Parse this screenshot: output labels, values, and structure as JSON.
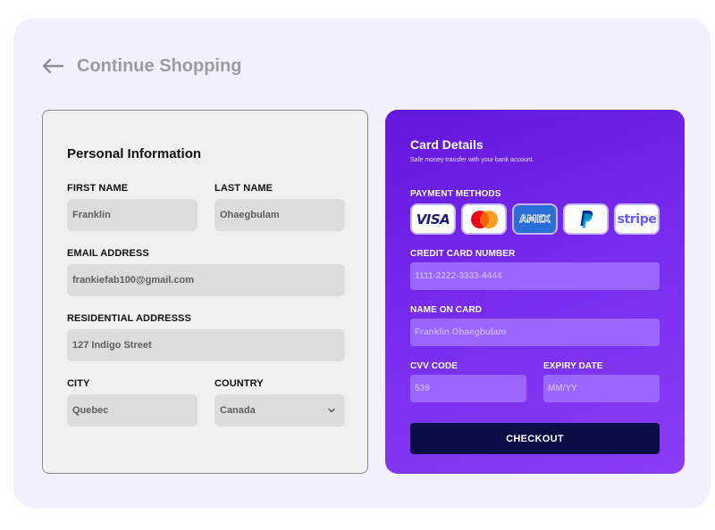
{
  "nav": {
    "back_label": "Continue Shopping",
    "back_icon": "arrow-left-icon"
  },
  "personal": {
    "title": "Personal Information",
    "first_name": {
      "label": "FIRST NAME",
      "value": "Franklin"
    },
    "last_name": {
      "label": "LAST NAME",
      "value": "Ohaegbulam"
    },
    "email": {
      "label": "EMAIL ADDRESS",
      "value": "frankiefab100@gmail.com"
    },
    "address": {
      "label": "RESIDENTIAL ADDRESSS",
      "value": "127 Indigo Street"
    },
    "city": {
      "label": "CITY",
      "value": "Quebec"
    },
    "country": {
      "label": "COUNTRY",
      "value": "Canada",
      "icon": "chevron-down-icon"
    }
  },
  "card": {
    "title": "Card Details",
    "subtitle": "Safe money transfer with your bank account.",
    "payment_methods_label": "PAYMENT METHODS",
    "methods": {
      "visa": "VISA",
      "mastercard": "mastercard-icon",
      "amex": "AMEX",
      "paypal": "paypal-icon",
      "stripe": "stripe"
    },
    "card_number": {
      "label": "CREDIT CARD NUMBER",
      "placeholder": "1111-2222-3333-4444"
    },
    "name_on_card": {
      "label": "NAME ON CARD",
      "placeholder": "Franklin Ohaegbulam"
    },
    "cvv": {
      "label": "CVV CODE",
      "placeholder": "539"
    },
    "expiry": {
      "label": "EXPIRY DATE",
      "placeholder": "MM/YY"
    },
    "checkout_label": "CHECKOUT"
  },
  "colors": {
    "page_bg": "#f3f0fd",
    "card_gradient_start": "#6316dc",
    "card_gradient_end": "#8a3cf6",
    "input_purple": "#9a66ff",
    "checkout_bg": "#0a0f47"
  }
}
